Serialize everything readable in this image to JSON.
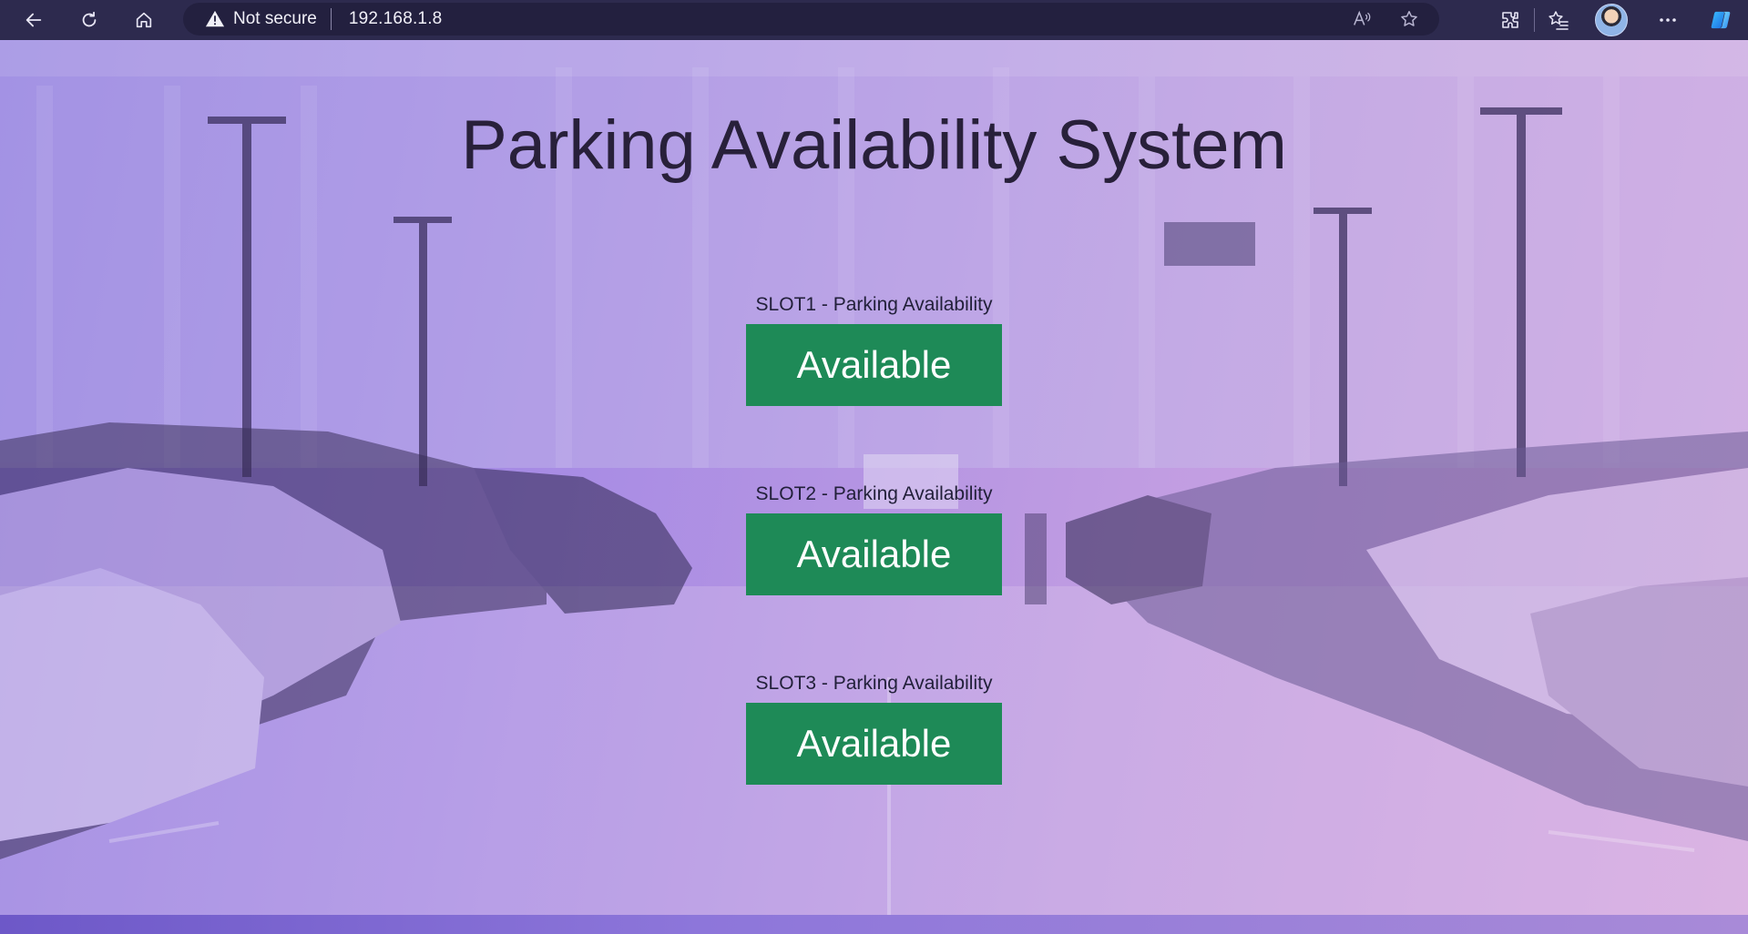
{
  "browser": {
    "security_label": "Not secure",
    "url": "192.168.1.8",
    "icons": [
      "back-icon",
      "reload-icon",
      "home-icon",
      "warning-icon",
      "read-aloud-icon",
      "favorite-star-icon",
      "extensions-icon",
      "favorites-icon",
      "profile-avatar",
      "more-icon",
      "copilot-icon"
    ]
  },
  "page": {
    "title": "Parking Availability System",
    "slots": [
      {
        "label": "SLOT1 - Parking Availability",
        "status": "Available"
      },
      {
        "label": "SLOT2 - Parking Availability",
        "status": "Available"
      },
      {
        "label": "SLOT3 - Parking Availability",
        "status": "Available"
      }
    ]
  },
  "colors": {
    "chrome": "#2d2a4e",
    "available": "#1e8a57",
    "overlay_start": "#8f79e0",
    "overlay_end": "#d7a8df"
  }
}
